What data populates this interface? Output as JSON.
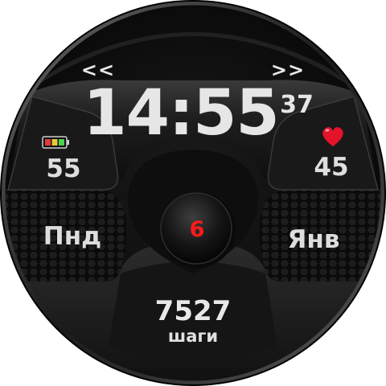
{
  "nav": {
    "prev_label": "<<",
    "next_label": ">>"
  },
  "clock": {
    "time": "14:55",
    "seconds": "37"
  },
  "battery": {
    "level": "55",
    "color_low": "#e23b3b",
    "color_mid": "#e6c83a",
    "color_high": "#4cd24c",
    "icon": "battery-icon"
  },
  "heart": {
    "rate": "45",
    "color": "#e4132a",
    "icon": "heart-icon"
  },
  "date": {
    "weekday": "Пнд",
    "month": "Янв",
    "day": "6",
    "day_color": "#ff1a1a"
  },
  "steps": {
    "count": "7527",
    "unit": "шаги"
  }
}
